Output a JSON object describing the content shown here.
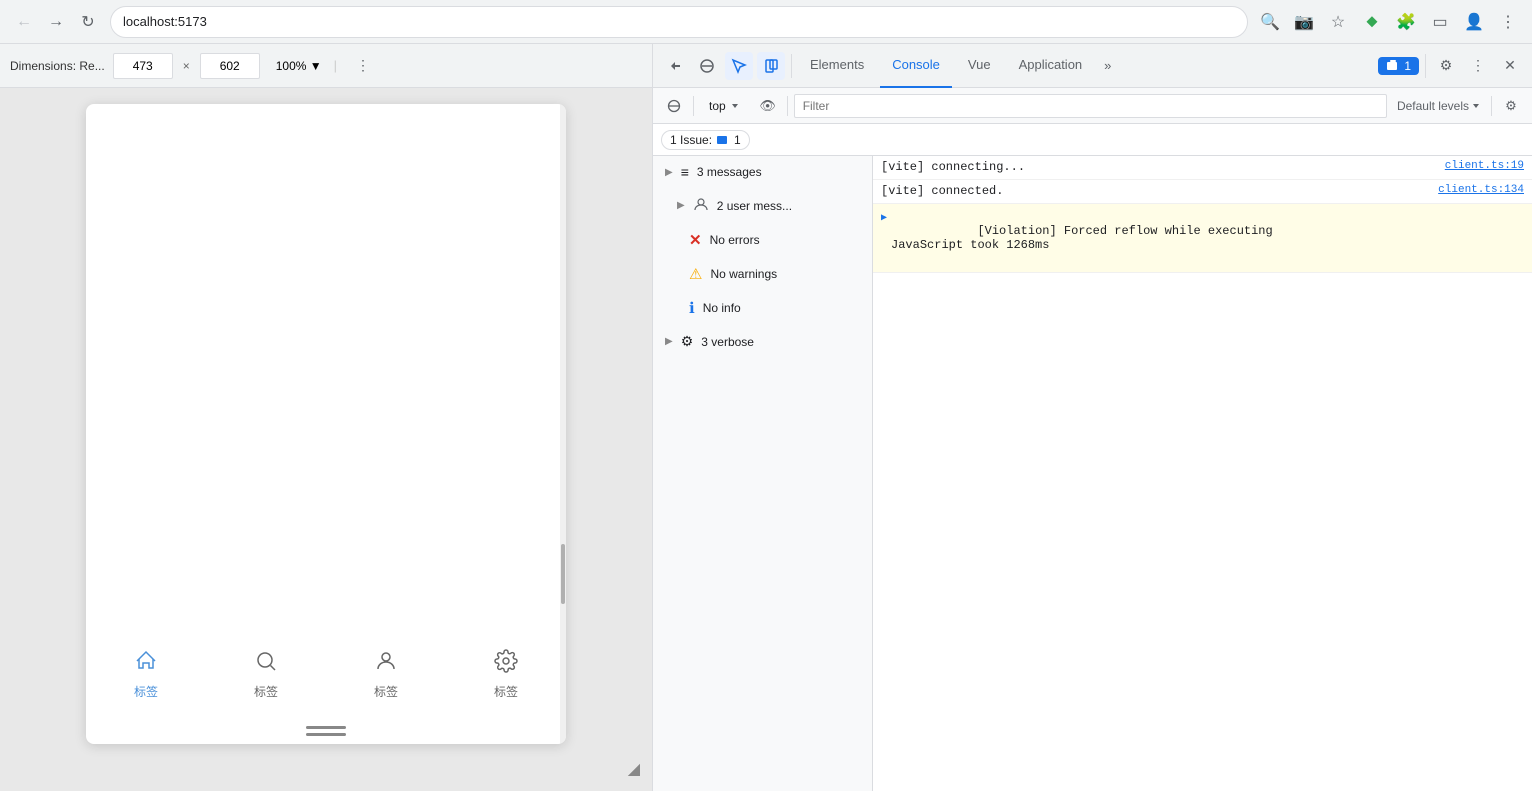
{
  "browser": {
    "url": "localhost:5173",
    "nav_back": "←",
    "nav_forward": "→",
    "nav_reload": "↻"
  },
  "device_toolbar": {
    "dimensions_label": "Dimensions: Re...",
    "width": "473",
    "height": "602",
    "zoom": "100% ▼",
    "more_icon": "⋮"
  },
  "devtools": {
    "tabs": [
      {
        "label": "Elements",
        "active": false
      },
      {
        "label": "Console",
        "active": true
      },
      {
        "label": "Vue",
        "active": false
      },
      {
        "label": "Application",
        "active": false
      }
    ],
    "more_tabs": "»",
    "issues_badge": "1",
    "issues_label": "1 Issue:",
    "settings_icon": "⚙",
    "more_icon": "⋮",
    "close_icon": "✕"
  },
  "console_toolbar": {
    "filter_placeholder": "Filter",
    "levels_label": "Default levels",
    "context_label": "top",
    "eye_icon": "👁"
  },
  "console_sidebar": {
    "items": [
      {
        "label": "3 messages",
        "icon": "≡",
        "hasArrow": true,
        "type": "all"
      },
      {
        "label": "2 user mess...",
        "icon": "👤",
        "hasArrow": true,
        "type": "user"
      },
      {
        "label": "No errors",
        "icon": "✕",
        "iconColor": "#d93025",
        "hasArrow": false,
        "type": "error"
      },
      {
        "label": "No warnings",
        "icon": "⚠",
        "iconColor": "#f9ab00",
        "hasArrow": false,
        "type": "warning"
      },
      {
        "label": "No info",
        "icon": "ℹ",
        "iconColor": "#1a73e8",
        "hasArrow": false,
        "type": "info"
      },
      {
        "label": "3 verbose",
        "icon": "⚙",
        "hasArrow": true,
        "type": "verbose"
      }
    ]
  },
  "console_log": {
    "entries": [
      {
        "text": "[vite] connecting...",
        "source": "client.ts:19",
        "type": "info",
        "hasArrow": false,
        "violation": false
      },
      {
        "text": "[vite] connected.",
        "source": "client.ts:134",
        "type": "info",
        "hasArrow": false,
        "violation": false
      },
      {
        "text": "[Violation] Forced reflow while executing\nJavaScript took 1268ms",
        "source": "",
        "type": "violation",
        "hasArrow": true,
        "violation": true
      }
    ]
  },
  "bottom_nav": {
    "items": [
      {
        "label": "标签",
        "active": true
      },
      {
        "label": "标签",
        "active": false
      },
      {
        "label": "标签",
        "active": false
      },
      {
        "label": "标签",
        "active": false
      }
    ]
  },
  "colors": {
    "active_tab": "#1a73e8",
    "violation_bg": "#fffde7",
    "error_icon": "#d93025",
    "warning_icon": "#f9ab00",
    "info_icon": "#1a73e8"
  }
}
